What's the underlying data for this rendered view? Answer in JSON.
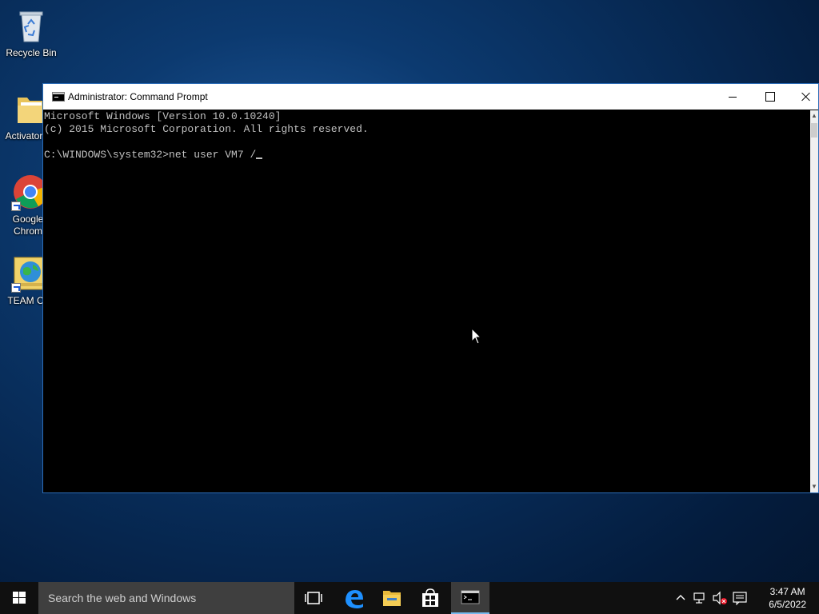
{
  "desktop": {
    "icons": [
      {
        "label": "Recycle Bin",
        "icon": "recycle-bin-icon"
      },
      {
        "label": "Activator",
        "icon": "folder-icon"
      },
      {
        "label": "Google Chrom",
        "icon": "chrome-icon"
      },
      {
        "label": "TEAM C",
        "icon": "globe-document-icon"
      }
    ]
  },
  "window": {
    "title": "Administrator: Command Prompt",
    "console_lines": [
      "Microsoft Windows [Version 10.0.10240]",
      "(c) 2015 Microsoft Corporation. All rights reserved.",
      "",
      "C:\\WINDOWS\\system32>net user VM7 /"
    ]
  },
  "taskbar": {
    "search_placeholder": "Search the web and Windows",
    "time": "3:47 AM",
    "date": "6/5/2022",
    "pinned": [
      "task-view-icon",
      "edge-icon",
      "file-explorer-icon",
      "store-icon",
      "command-prompt-icon"
    ],
    "accent": "#76b9ed"
  }
}
